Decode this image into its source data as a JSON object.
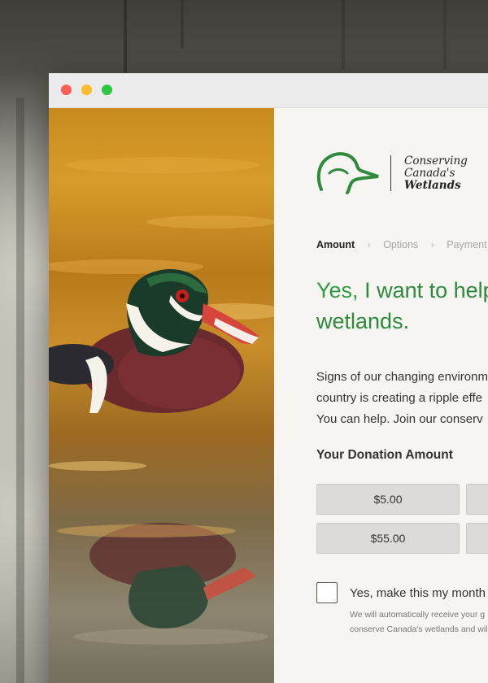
{
  "brand": {
    "line1": "Conserving",
    "line2": "Canada's",
    "line3": "Wetlands",
    "icon": "duck-head-logo-icon",
    "color": "#2f8a3b"
  },
  "steps": [
    {
      "label": "Amount",
      "active": true
    },
    {
      "label": "Options",
      "active": false
    },
    {
      "label": "Payment",
      "active": false
    }
  ],
  "step_separator_icon": "chevron-right-icon",
  "headline": {
    "lead": "Yes,",
    "rest_line1": " I want to help",
    "line2": "wetlands."
  },
  "intro": {
    "line1": "Signs of our changing environm",
    "line2": "country is creating a ripple effe",
    "line3": "You can help. Join our conserv"
  },
  "donation": {
    "title": "Your Donation Amount",
    "amounts": [
      "$5.00",
      "$55.00"
    ]
  },
  "monthly": {
    "label": "Yes, make this my month",
    "note_line1": "We will automatically receive your g",
    "note_line2": "conserve Canada's wetlands and wil",
    "checked": false
  },
  "colors": {
    "accent": "#2f8a3b",
    "button_bg": "#dcdbd7",
    "window_bg": "#f6f5f2"
  }
}
